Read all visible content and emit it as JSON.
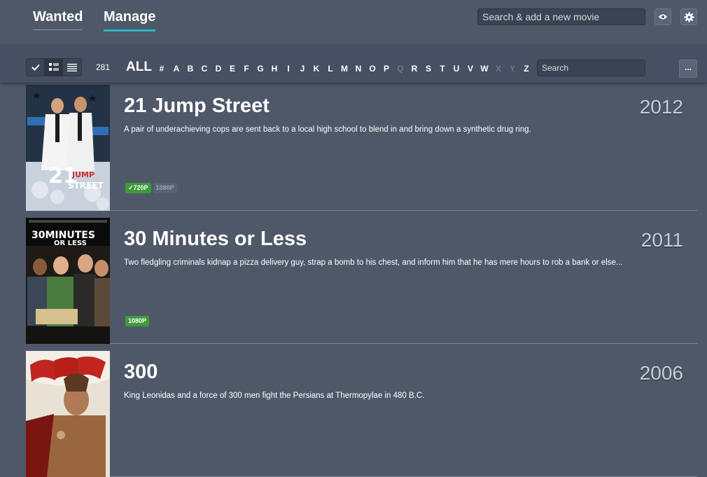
{
  "nav": {
    "wanted_label": "Wanted",
    "manage_label": "Manage"
  },
  "header": {
    "search_placeholder": "Search & add a new movie",
    "icons": [
      "eye-icon",
      "gear-icon"
    ]
  },
  "filter": {
    "count": "281",
    "letters": [
      "ALL",
      "#",
      "A",
      "B",
      "C",
      "D",
      "E",
      "F",
      "G",
      "H",
      "I",
      "J",
      "K",
      "L",
      "M",
      "N",
      "O",
      "P",
      "Q",
      "R",
      "S",
      "T",
      "U",
      "V",
      "W",
      "X",
      "Y",
      "Z"
    ],
    "disabled_letters": [
      "Q",
      "X",
      "Y"
    ],
    "search_placeholder": "Search",
    "more_label": "..."
  },
  "movies": [
    {
      "title": "21 Jump Street",
      "year": "2012",
      "plot": "A pair of underachieving cops are sent back to a local high school to blend in and bring down a synthetic drug ring.",
      "qualities": [
        {
          "label": "✓720P",
          "status": "done"
        },
        {
          "label": "1080P",
          "status": "wanted"
        }
      ]
    },
    {
      "title": "30 Minutes or Less",
      "year": "2011",
      "plot": "Two fledgling criminals kidnap a pizza delivery guy, strap a bomb to his chest, and inform him that he has mere hours to rob a bank or else...",
      "qualities": [
        {
          "label": "1080P",
          "status": "done"
        }
      ]
    },
    {
      "title": "300",
      "year": "2006",
      "plot": "King Leonidas and a force of 300 men fight the Persians at Thermopylae in 480 B.C.",
      "qualities": []
    }
  ],
  "colors": {
    "accent": "#25b9c4",
    "quality_done": "#3f9a3c",
    "background": "#4e5869"
  }
}
